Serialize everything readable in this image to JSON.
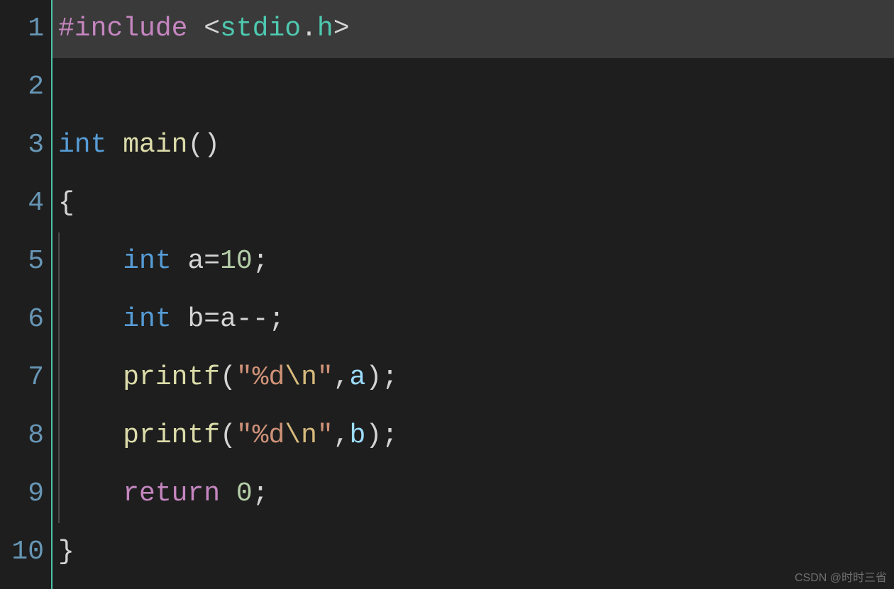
{
  "lineNumbers": [
    "1",
    "2",
    "3",
    "4",
    "5",
    "6",
    "7",
    "8",
    "9",
    "10"
  ],
  "code": {
    "l1": {
      "include": "#include",
      "sp1": " ",
      "lt": "<",
      "lib": "stdio",
      "dot": ".",
      "h": "h",
      "gt": ">"
    },
    "l3": {
      "int": "int",
      "sp": " ",
      "main": "main",
      "parens": "()"
    },
    "l4": {
      "brace": "{"
    },
    "l5": {
      "indent": "    ",
      "int": "int",
      "sp": " ",
      "var": "a",
      "eq": "=",
      "num": "10",
      "semi": ";"
    },
    "l6": {
      "indent": "    ",
      "int": "int",
      "sp": " ",
      "var": "b",
      "eq": "=",
      "rhs": "a",
      "dec": "--",
      "semi": ";"
    },
    "l7": {
      "indent": "    ",
      "fn": "printf",
      "lp": "(",
      "q1": "\"",
      "fmt": "%d",
      "esc": "\\n",
      "q2": "\"",
      "comma": ",",
      "arg": "a",
      "rp": ")",
      "semi": ";"
    },
    "l8": {
      "indent": "    ",
      "fn": "printf",
      "lp": "(",
      "q1": "\"",
      "fmt": "%d",
      "esc": "\\n",
      "q2": "\"",
      "comma": ",",
      "arg": "b",
      "rp": ")",
      "semi": ";"
    },
    "l9": {
      "indent": "    ",
      "ret": "return",
      "sp": " ",
      "zero": "0",
      "semi": ";"
    },
    "l10": {
      "brace": "}"
    }
  },
  "watermark": "CSDN @时时三省"
}
